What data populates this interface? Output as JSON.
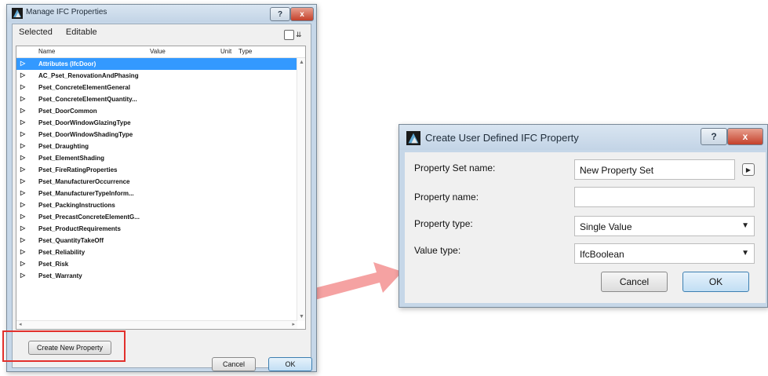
{
  "manage": {
    "title": "Manage IFC Properties",
    "filters": [
      "Selected",
      "Editable"
    ],
    "columns": {
      "name": "Name",
      "value": "Value",
      "unit": "Unit",
      "type": "Type"
    },
    "rows": [
      "Attributes (IfcDoor)",
      "AC_Pset_RenovationAndPhasing",
      "Pset_ConcreteElementGeneral",
      "Pset_ConcreteElementQuantity...",
      "Pset_DoorCommon",
      "Pset_DoorWindowGlazingType",
      "Pset_DoorWindowShadingType",
      "Pset_Draughting",
      "Pset_ElementShading",
      "Pset_FireRatingProperties",
      "Pset_ManufacturerOccurrence",
      "Pset_ManufacturerTypeInform...",
      "Pset_PackingInstructions",
      "Pset_PrecastConcreteElementG...",
      "Pset_ProductRequirements",
      "Pset_QuantityTakeOff",
      "Pset_Reliability",
      "Pset_Risk",
      "Pset_Warranty"
    ],
    "selected_row": "Attributes (IfcDoor)",
    "create_button": "Create New Property",
    "cancel": "Cancel",
    "ok": "OK"
  },
  "create": {
    "title": "Create User Defined IFC Property",
    "fields": {
      "property_set_name": {
        "label": "Property Set name:",
        "value": "New Property Set"
      },
      "property_name": {
        "label": "Property name:",
        "value": ""
      },
      "property_type": {
        "label": "Property type:",
        "value": "Single Value"
      },
      "value_type": {
        "label": "Value type:",
        "value": "IfcBoolean"
      }
    },
    "cancel": "Cancel",
    "ok": "OK"
  },
  "titlebar_buttons": {
    "help": "?",
    "close": "x"
  },
  "colors": {
    "selection": "#3399ff",
    "highlight_box": "#e2302c",
    "arrow": "#f28b8b",
    "primary_button": "#3c7fb1"
  },
  "icons": [
    "app-icon",
    "help-icon",
    "close-icon",
    "expand-triangle-icon",
    "view-options-icon",
    "dropdown-caret-icon",
    "set-picker-arrow-icon",
    "pointer-arrow"
  ]
}
